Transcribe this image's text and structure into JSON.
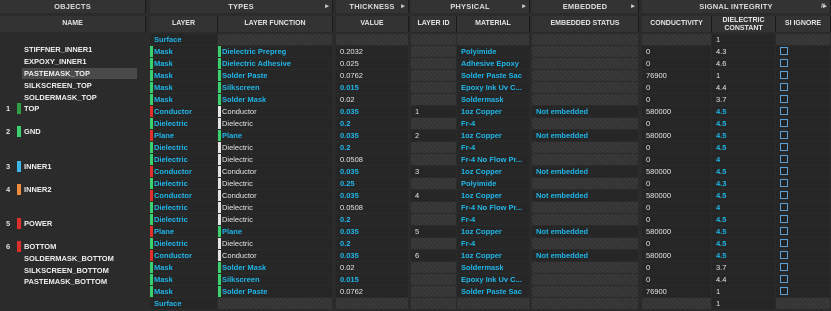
{
  "groups": {
    "objects": "OBJECTS",
    "types": "TYPES",
    "thickness": "THICKNESS",
    "physical": "PHYSICAL",
    "embedded": "EMBEDDED",
    "signal": "SIGNAL INTEGRITY"
  },
  "columns": {
    "name": "NAME",
    "layer": "LAYER",
    "layer_function": "LAYER FUNCTION",
    "value": "VALUE",
    "layer_id": "LAYER ID",
    "material": "MATERIAL",
    "embedded_status": "EMBEDDED STATUS",
    "conductivity": "CONDUCTIVITY",
    "dielectric_constant": "DIELECTRIC CONSTANT",
    "si_ignore": "SI IGNORE",
    "index": "#"
  },
  "objects": [
    {
      "name": "STIFFNER_INNER1",
      "num": "",
      "color": ""
    },
    {
      "name": "EXPOXY_INNER1",
      "num": "",
      "color": ""
    },
    {
      "name": "PASTEMASK_TOP",
      "num": "",
      "color": "",
      "selected": true
    },
    {
      "name": "SILKSCREEN_TOP",
      "num": "",
      "color": ""
    },
    {
      "name": "SOLDERMASK_TOP",
      "num": "",
      "color": ""
    },
    {
      "name": "TOP",
      "num": "1",
      "color": "#2f9e44"
    },
    {
      "name": "GND",
      "num": "2",
      "color": "#3bd16f"
    },
    {
      "name": "INNER1",
      "num": "3",
      "color": "#3fb6e8"
    },
    {
      "name": "INNER2",
      "num": "4",
      "color": "#f08a3c"
    },
    {
      "name": "POWER",
      "num": "5",
      "color": "#e0302c"
    },
    {
      "name": "BOTTOM",
      "num": "6",
      "color": "#d9302c"
    },
    {
      "name": "SOLDERMASK_BOTTOM",
      "num": "",
      "color": ""
    },
    {
      "name": "SILKSCREEN_BOTTOM",
      "num": "",
      "color": ""
    },
    {
      "name": "PASTEMASK_BOTTOM",
      "num": "",
      "color": ""
    }
  ],
  "rows": [
    {
      "layer": "Surface",
      "func": "",
      "value": "",
      "id": "",
      "material": "",
      "emb": "",
      "cond": "",
      "dk": "1",
      "chk": false,
      "bar": "",
      "fbar": ""
    },
    {
      "layer": "Mask",
      "func": "Dielectric Prepreg",
      "value": "0.2032",
      "id": "",
      "material": "Polyimide",
      "emb": "",
      "cond": "0",
      "dk": "4.3",
      "chk": true,
      "bar": "#3bd16f",
      "fbar": "#3bd16f"
    },
    {
      "layer": "Mask",
      "func": "Dielectric Adhesive",
      "value": "0.025",
      "id": "",
      "material": "Adhesive Epoxy",
      "emb": "",
      "cond": "0",
      "dk": "4.6",
      "chk": true,
      "bar": "#3bd16f",
      "fbar": "#3bd16f"
    },
    {
      "layer": "Mask",
      "func": "Solder Paste",
      "value": "0.0762",
      "id": "",
      "material": "Solder Paste Sac",
      "emb": "",
      "cond": "76900",
      "dk": "1",
      "chk": true,
      "bar": "#3bd16f",
      "fbar": "#3bd16f"
    },
    {
      "layer": "Mask",
      "func": "Silkscreen",
      "value": "0.015",
      "id": "",
      "material": "Epoxy Ink Uv C...",
      "emb": "",
      "cond": "0",
      "dk": "4.4",
      "chk": true,
      "bar": "#3bd16f",
      "fbar": "#3bd16f"
    },
    {
      "layer": "Mask",
      "func": "Solder Mask",
      "value": "0.02",
      "id": "",
      "material": "Soldermask",
      "emb": "",
      "cond": "0",
      "dk": "3.7",
      "chk": true,
      "bar": "#3bd16f",
      "fbar": "#3bd16f"
    },
    {
      "layer": "Conductor",
      "func": "Conductor",
      "value": "0.035",
      "id": "1",
      "material": "1oz Copper",
      "emb": "Not embedded",
      "cond": "580000",
      "dk": "4.5",
      "chk": true,
      "bar": "#e0302c",
      "fbar": "#e6e6e6"
    },
    {
      "layer": "Dielectric",
      "func": "Dielectric",
      "value": "0.2",
      "id": "",
      "material": "Fr-4",
      "emb": "",
      "cond": "0",
      "dk": "4.5",
      "chk": true,
      "bar": "#3bd16f",
      "fbar": "#e6e6e6"
    },
    {
      "layer": "Plane",
      "func": "Plane",
      "value": "0.035",
      "id": "2",
      "material": "1oz Copper",
      "emb": "Not embedded",
      "cond": "580000",
      "dk": "4.5",
      "chk": true,
      "bar": "#e0302c",
      "fbar": "#3bd16f"
    },
    {
      "layer": "Dielectric",
      "func": "Dielectric",
      "value": "0.2",
      "id": "",
      "material": "Fr-4",
      "emb": "",
      "cond": "0",
      "dk": "4.5",
      "chk": true,
      "bar": "#3bd16f",
      "fbar": "#e6e6e6"
    },
    {
      "layer": "Dielectric",
      "func": "Dielectric",
      "value": "0.0508",
      "id": "",
      "material": "Fr-4 No Flow Pr...",
      "emb": "",
      "cond": "0",
      "dk": "4",
      "chk": true,
      "bar": "#3bd16f",
      "fbar": "#e6e6e6"
    },
    {
      "layer": "Conductor",
      "func": "Conductor",
      "value": "0.035",
      "id": "3",
      "material": "1oz Copper",
      "emb": "Not embedded",
      "cond": "580000",
      "dk": "4.5",
      "chk": true,
      "bar": "#e0302c",
      "fbar": "#e6e6e6"
    },
    {
      "layer": "Dielectric",
      "func": "Dielectric",
      "value": "0.25",
      "id": "",
      "material": "Polyimide",
      "emb": "",
      "cond": "0",
      "dk": "4.3",
      "chk": true,
      "bar": "#3bd16f",
      "fbar": "#e6e6e6"
    },
    {
      "layer": "Conductor",
      "func": "Conductor",
      "value": "0.035",
      "id": "4",
      "material": "1oz Copper",
      "emb": "Not embedded",
      "cond": "580000",
      "dk": "4.5",
      "chk": true,
      "bar": "#e0302c",
      "fbar": "#e6e6e6"
    },
    {
      "layer": "Dielectric",
      "func": "Dielectric",
      "value": "0.0508",
      "id": "",
      "material": "Fr-4 No Flow Pr...",
      "emb": "",
      "cond": "0",
      "dk": "4",
      "chk": true,
      "bar": "#3bd16f",
      "fbar": "#e6e6e6"
    },
    {
      "layer": "Dielectric",
      "func": "Dielectric",
      "value": "0.2",
      "id": "",
      "material": "Fr-4",
      "emb": "",
      "cond": "0",
      "dk": "4.5",
      "chk": true,
      "bar": "#3bd16f",
      "fbar": "#e6e6e6"
    },
    {
      "layer": "Plane",
      "func": "Plane",
      "value": "0.035",
      "id": "5",
      "material": "1oz Copper",
      "emb": "Not embedded",
      "cond": "580000",
      "dk": "4.5",
      "chk": true,
      "bar": "#e0302c",
      "fbar": "#3bd16f"
    },
    {
      "layer": "Dielectric",
      "func": "Dielectric",
      "value": "0.2",
      "id": "",
      "material": "Fr-4",
      "emb": "",
      "cond": "0",
      "dk": "4.5",
      "chk": true,
      "bar": "#3bd16f",
      "fbar": "#e6e6e6"
    },
    {
      "layer": "Conductor",
      "func": "Conductor",
      "value": "0.035",
      "id": "6",
      "material": "1oz Copper",
      "emb": "Not embedded",
      "cond": "580000",
      "dk": "4.5",
      "chk": true,
      "bar": "#e0302c",
      "fbar": "#e6e6e6"
    },
    {
      "layer": "Mask",
      "func": "Solder Mask",
      "value": "0.02",
      "id": "",
      "material": "Soldermask",
      "emb": "",
      "cond": "0",
      "dk": "3.7",
      "chk": true,
      "bar": "#3bd16f",
      "fbar": "#3bd16f"
    },
    {
      "layer": "Mask",
      "func": "Silkscreen",
      "value": "0.015",
      "id": "",
      "material": "Epoxy Ink Uv C...",
      "emb": "",
      "cond": "0",
      "dk": "4.4",
      "chk": true,
      "bar": "#3bd16f",
      "fbar": "#3bd16f"
    },
    {
      "layer": "Mask",
      "func": "Solder Paste",
      "value": "0.0762",
      "id": "",
      "material": "Solder Paste Sac",
      "emb": "",
      "cond": "76900",
      "dk": "1",
      "chk": true,
      "bar": "#3bd16f",
      "fbar": "#3bd16f"
    },
    {
      "layer": "Surface",
      "func": "",
      "value": "",
      "id": "",
      "material": "",
      "emb": "",
      "cond": "",
      "dk": "1",
      "chk": false,
      "bar": "",
      "fbar": ""
    }
  ]
}
